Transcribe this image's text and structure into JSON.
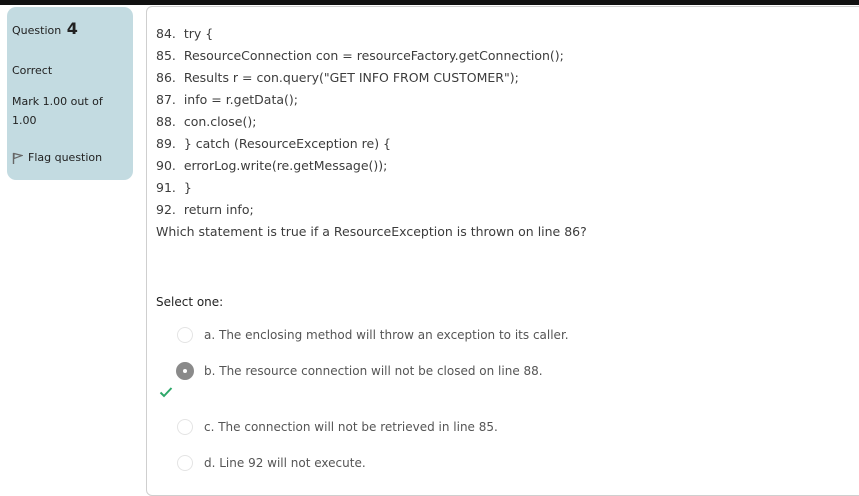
{
  "info": {
    "question_label": "Question",
    "question_number": "4",
    "state": "Correct",
    "grade": "Mark 1.00 out of 1.00",
    "flag_label": "Flag question"
  },
  "code_lines": [
    "84.  try {",
    "85.  ResourceConnection con = resourceFactory.getConnection();",
    "86.  Results r = con.query(\"GET INFO FROM CUSTOMER\");",
    "87.  info = r.getData();",
    "88.  con.close();",
    "89.  } catch (ResourceException re) {",
    "90.  errorLog.write(re.getMessage());",
    "91.  }",
    "92.  return info;"
  ],
  "question_text": "Which statement is true if a ResourceException is thrown on line 86?",
  "select_prompt": "Select one:",
  "options": [
    {
      "label": "a. The enclosing method will throw an exception to its caller.",
      "selected": false
    },
    {
      "label": "b. The resource connection will not be closed on line 88.",
      "selected": true
    },
    {
      "label": "c. The connection will not be retrieved in line 85.",
      "selected": false
    },
    {
      "label": "d. Line 92 will not execute.",
      "selected": false
    }
  ],
  "colors": {
    "info_panel": "#c3dbe1",
    "correct_check": "#2ea86a",
    "selected_radio": "#8a8a8a"
  },
  "icons": {
    "flag": "flag-icon",
    "correct": "checkmark-icon"
  }
}
